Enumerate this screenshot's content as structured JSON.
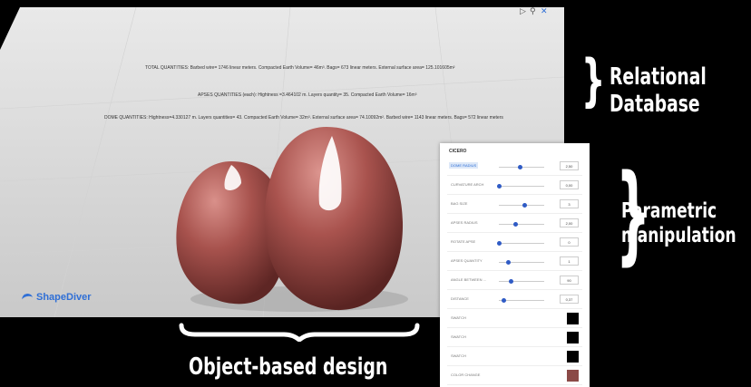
{
  "viewer": {
    "toolbar_icons": [
      "play-icon",
      "search-icon",
      "expand-icon"
    ],
    "total_quantities": "TOTAL QUANTITIES: Barbed wire= 1746 linear meters. Compacted Earth Volume= 46m³. Bags= 673 linear meters. External surface area= 125.101605m²",
    "apses_quantities": "APSES QUANTITIES (each): Hightness =3.464102 m. Layers quantity= 35. Compacted Earth Volume= 16m³",
    "dome_quantities": "DOME QUANTITIES: Hightness=4.330127 m. Layers quantities= 43. Compacted Earth Volume= 32m³. External surface area= 74.10092m². Barbed wire= 1143 linear meters. Bags= 572 linear meters",
    "logo": "ShapeDiver"
  },
  "captions": {
    "relational_line1": "Relational",
    "relational_line2": "Database",
    "parametric_line1": "Parametric",
    "parametric_line2": "manipulation",
    "object": "Object-based design"
  },
  "panel": {
    "title": "CICERO",
    "params": [
      {
        "label": "DOME RADIUS",
        "value": "2,50",
        "level": 0.45,
        "active": true
      },
      {
        "label": "CURVATURE ARCH",
        "value": "0,00",
        "level": 0.0
      },
      {
        "label": "BAG SIZE",
        "value": "3",
        "level": 0.55
      },
      {
        "label": "APSES RADIUS",
        "value": "2,00",
        "level": 0.35
      },
      {
        "label": "ROTATE APSE",
        "value": "0",
        "level": 0.0
      },
      {
        "label": "APSES QUANTITY",
        "value": "1",
        "level": 0.2
      },
      {
        "label": "ANGLE BETWEEN ...",
        "value": "90",
        "level": 0.25
      },
      {
        "label": "DISTANCE",
        "value": "0,37",
        "level": 0.1
      }
    ],
    "swatches": [
      {
        "label": "SWATCH",
        "color": "#000000"
      },
      {
        "label": "SWATCH",
        "color": "#000000"
      },
      {
        "label": "SWATCH",
        "color": "#000000"
      },
      {
        "label": "COLOR CHANGE",
        "color": "#8b4a47"
      }
    ]
  }
}
